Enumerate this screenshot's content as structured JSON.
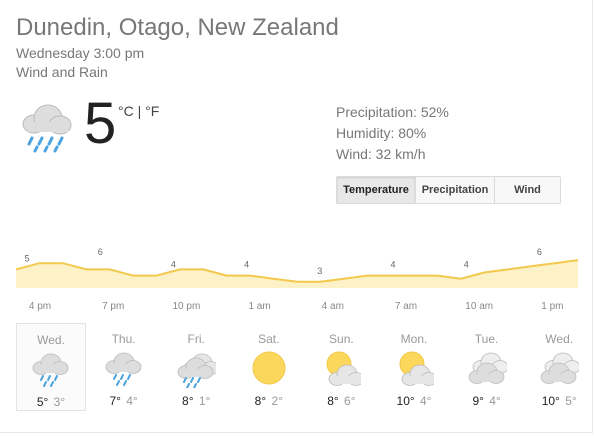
{
  "header": {
    "location": "Dunedin, Otago, New Zealand",
    "datetime": "Wednesday 3:00 pm",
    "condition": "Wind and Rain"
  },
  "current": {
    "icon": "rain-cloud-icon",
    "temperature": "5",
    "unit_c": "°C",
    "unit_sep": " | ",
    "unit_f": "°F"
  },
  "details": {
    "precipitation": "Precipitation: 52%",
    "humidity": "Humidity: 80%",
    "wind": "Wind: 32 km/h"
  },
  "tabs": [
    {
      "label": "Temperature",
      "active": true
    },
    {
      "label": "Precipitation",
      "active": false
    },
    {
      "label": "Wind",
      "active": false
    }
  ],
  "chart_data": {
    "type": "area",
    "hour_labels": [
      "4 pm",
      "7 pm",
      "10 pm",
      "1 am",
      "4 am",
      "7 am",
      "10 am",
      "1 pm"
    ],
    "value_labels": [
      "5",
      "6",
      "4",
      "4",
      "3",
      "4",
      "4",
      "6"
    ],
    "values": [
      5,
      6,
      6,
      5,
      5,
      4,
      4,
      5,
      5,
      4,
      4,
      3.5,
      3,
      3,
      3.5,
      4,
      4,
      4,
      4,
      3.5,
      4.5,
      5,
      5.5,
      6,
      6.5
    ],
    "line_color": "#f2c94c",
    "fill_color": "#fdf1c8"
  },
  "forecast": [
    {
      "day": "Wed.",
      "hi": "5°",
      "lo": "3°",
      "icon": "rain-cloud-icon"
    },
    {
      "day": "Thu.",
      "hi": "7°",
      "lo": "4°",
      "icon": "rain-cloud-icon"
    },
    {
      "day": "Fri.",
      "hi": "8°",
      "lo": "1°",
      "icon": "rain-clouds-icon"
    },
    {
      "day": "Sat.",
      "hi": "8°",
      "lo": "2°",
      "icon": "sun-icon"
    },
    {
      "day": "Sun.",
      "hi": "8°",
      "lo": "6°",
      "icon": "partly-cloudy-icon"
    },
    {
      "day": "Mon.",
      "hi": "10°",
      "lo": "4°",
      "icon": "partly-cloudy-icon"
    },
    {
      "day": "Tue.",
      "hi": "9°",
      "lo": "4°",
      "icon": "cloudy-icon"
    },
    {
      "day": "Wed.",
      "hi": "10°",
      "lo": "5°",
      "icon": "cloudy-icon"
    }
  ],
  "colors": {
    "sun": "#fbd75b",
    "cloud": "#dddddd",
    "cloud_outline": "#bbbbbb",
    "rain": "#4aa3df"
  }
}
